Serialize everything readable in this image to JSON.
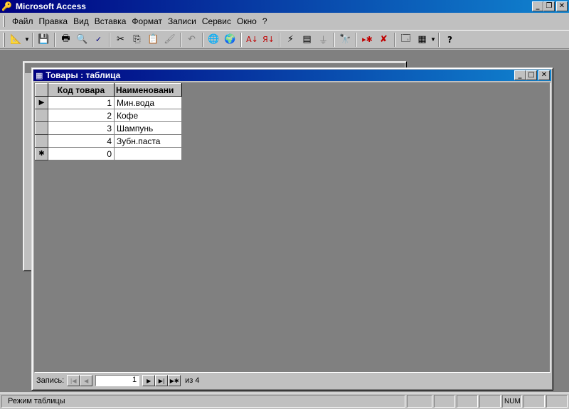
{
  "app": {
    "title": "Microsoft Access"
  },
  "menu": [
    "Файл",
    "Правка",
    "Вид",
    "Вставка",
    "Формат",
    "Записи",
    "Сервис",
    "Окно",
    "?"
  ],
  "toolbar": {
    "icons": [
      "view-design-icon",
      "save-icon",
      "print-icon",
      "print-preview-icon",
      "spelling-icon",
      "cut-icon",
      "copy-icon",
      "paste-icon",
      "format-painter-icon",
      "undo-icon",
      "insert-hyperlink-icon",
      "web-toolbar-icon",
      "sort-ascending-icon",
      "sort-descending-icon",
      "filter-by-selection-icon",
      "filter-by-form-icon",
      "apply-filter-icon",
      "find-icon",
      "new-record-icon",
      "delete-record-icon",
      "database-window-icon",
      "new-object-icon",
      "help-icon"
    ]
  },
  "table_window": {
    "title": "Товары : таблица",
    "columns": [
      "Код товара",
      "Наименовани"
    ],
    "rows": [
      {
        "selector": "current",
        "code": "1",
        "name": "Мин.вода"
      },
      {
        "selector": "",
        "code": "2",
        "name": "Кофе"
      },
      {
        "selector": "",
        "code": "3",
        "name": "Шампунь"
      },
      {
        "selector": "",
        "code": "4",
        "name": "Зубн.паста"
      },
      {
        "selector": "new",
        "code": "0",
        "name": ""
      }
    ],
    "selector_glyphs": {
      "current": "▶",
      "new": "✱"
    }
  },
  "navigator": {
    "label": "Запись:",
    "current": "1",
    "of_label": "из 4"
  },
  "statusbar": {
    "text": "Режим таблицы",
    "indicators": [
      "",
      "",
      "",
      "",
      "NUM",
      "",
      ""
    ]
  }
}
